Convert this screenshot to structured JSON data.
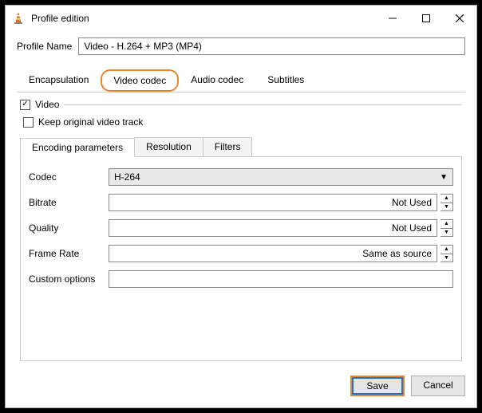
{
  "window": {
    "title": "Profile edition"
  },
  "profile": {
    "label": "Profile Name",
    "value": "Video - H.264 + MP3 (MP4)"
  },
  "tabs": {
    "encapsulation": "Encapsulation",
    "video_codec": "Video codec",
    "audio_codec": "Audio codec",
    "subtitles": "Subtitles"
  },
  "video": {
    "video_label": "Video",
    "keep_original_label": "Keep original video track"
  },
  "subtabs": {
    "encoding": "Encoding parameters",
    "resolution": "Resolution",
    "filters": "Filters"
  },
  "encoding": {
    "codec_label": "Codec",
    "codec_value": "H-264",
    "bitrate_label": "Bitrate",
    "bitrate_value": "Not Used",
    "quality_label": "Quality",
    "quality_value": "Not Used",
    "framerate_label": "Frame Rate",
    "framerate_value": "Same as source",
    "custom_label": "Custom options",
    "custom_value": ""
  },
  "buttons": {
    "save": "Save",
    "cancel": "Cancel"
  }
}
